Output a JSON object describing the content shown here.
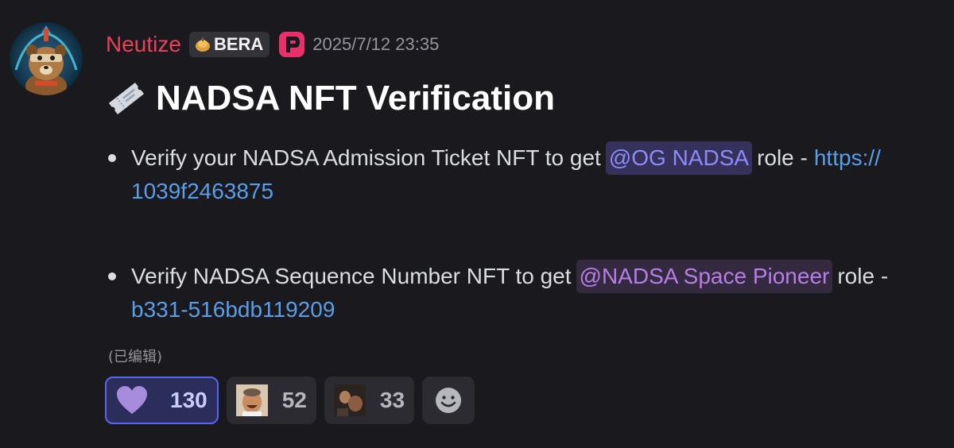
{
  "message": {
    "author": "Neutize",
    "guild_tag": "BERA",
    "timestamp": "2025/7/12 23:35",
    "title_icon": "ticket-icon",
    "title": "NADSA NFT Verification",
    "bullets": [
      {
        "text_before": "Verify your NADSA Admission Ticket NFT to get",
        "mention": "@OG NADSA",
        "text_after": "role -",
        "link_start": "https://",
        "link_cont": "1039f2463875"
      },
      {
        "text_before": "Verify NADSA Sequence Number NFT to get",
        "mention": "@NADSA Space Pioneer",
        "text_after": "role -",
        "link_start": "",
        "link_cont": "b331-516bdb119209"
      }
    ],
    "edited_label": "(已编辑)"
  },
  "reactions": [
    {
      "icon": "purple-heart-icon",
      "count": "130",
      "active": true
    },
    {
      "icon": "laughing-man-gif-icon",
      "count": "52",
      "active": false
    },
    {
      "icon": "clapping-gif-icon",
      "count": "33",
      "active": false
    }
  ],
  "add_reaction_icon": "add-reaction-smiley-icon",
  "colors": {
    "background": "#1a1a1e",
    "username": "#e8415c",
    "mention_blue": "#8b8cf8",
    "mention_purple": "#b77ee6",
    "link": "#5a9de8",
    "active_reaction_border": "#5865f2"
  }
}
